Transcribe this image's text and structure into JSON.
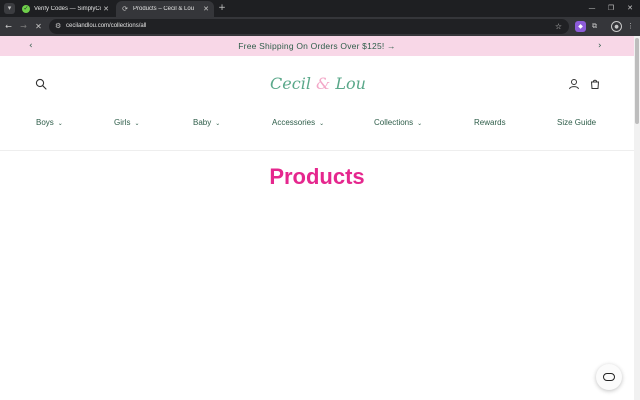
{
  "browser": {
    "tabs": [
      {
        "title": "Verify Codes — SimplyCodes",
        "favicon": "check-badge-icon",
        "active": false
      },
      {
        "title": "Products – Cecil & Lou",
        "favicon": "loading-icon",
        "active": true
      }
    ],
    "url": "cecilandlou.com/collections/all"
  },
  "announcement": {
    "text": "Free Shipping On Orders Over $125!",
    "arrow": "→"
  },
  "logo": {
    "first": "Cecil",
    "amp": "&",
    "second": "Lou"
  },
  "nav": [
    {
      "label": "Boys",
      "has_dropdown": true
    },
    {
      "label": "Girls",
      "has_dropdown": true
    },
    {
      "label": "Baby",
      "has_dropdown": true
    },
    {
      "label": "Accessories",
      "has_dropdown": true
    },
    {
      "label": "Collections",
      "has_dropdown": true
    },
    {
      "label": "Rewards",
      "has_dropdown": false
    },
    {
      "label": "Size Guide",
      "has_dropdown": false
    }
  ],
  "main": {
    "title": "Products"
  },
  "colors": {
    "announcement_bg": "#f8d7e7",
    "brand_green": "#2f5e4a",
    "title_pink": "#e5278e"
  }
}
